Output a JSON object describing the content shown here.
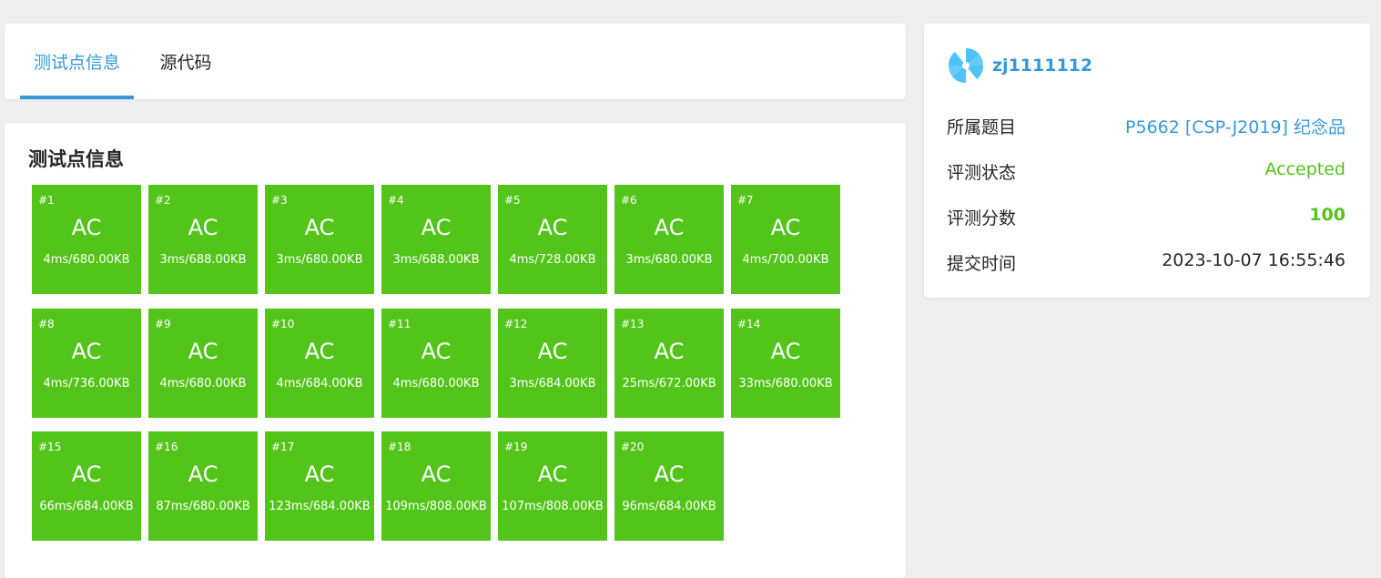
{
  "tabs": [
    {
      "label": "测试点信息",
      "active": true
    },
    {
      "label": "源代码",
      "active": false
    }
  ],
  "testcases": {
    "title": "测试点信息",
    "status_color": "#52c41a",
    "cases": [
      {
        "id": "#1",
        "status": "AC",
        "usage": "4ms/680.00KB"
      },
      {
        "id": "#2",
        "status": "AC",
        "usage": "3ms/688.00KB"
      },
      {
        "id": "#3",
        "status": "AC",
        "usage": "3ms/680.00KB"
      },
      {
        "id": "#4",
        "status": "AC",
        "usage": "3ms/688.00KB"
      },
      {
        "id": "#5",
        "status": "AC",
        "usage": "4ms/728.00KB"
      },
      {
        "id": "#6",
        "status": "AC",
        "usage": "3ms/680.00KB"
      },
      {
        "id": "#7",
        "status": "AC",
        "usage": "4ms/700.00KB"
      },
      {
        "id": "#8",
        "status": "AC",
        "usage": "4ms/736.00KB"
      },
      {
        "id": "#9",
        "status": "AC",
        "usage": "4ms/680.00KB"
      },
      {
        "id": "#10",
        "status": "AC",
        "usage": "4ms/684.00KB"
      },
      {
        "id": "#11",
        "status": "AC",
        "usage": "4ms/680.00KB"
      },
      {
        "id": "#12",
        "status": "AC",
        "usage": "3ms/684.00KB"
      },
      {
        "id": "#13",
        "status": "AC",
        "usage": "25ms/672.00KB"
      },
      {
        "id": "#14",
        "status": "AC",
        "usage": "33ms/680.00KB"
      },
      {
        "id": "#15",
        "status": "AC",
        "usage": "66ms/684.00KB"
      },
      {
        "id": "#16",
        "status": "AC",
        "usage": "87ms/680.00KB"
      },
      {
        "id": "#17",
        "status": "AC",
        "usage": "123ms/684.00KB"
      },
      {
        "id": "#18",
        "status": "AC",
        "usage": "109ms/808.00KB"
      },
      {
        "id": "#19",
        "status": "AC",
        "usage": "107ms/808.00KB"
      },
      {
        "id": "#20",
        "status": "AC",
        "usage": "96ms/684.00KB"
      }
    ]
  },
  "info": {
    "username": "zj1111112",
    "avatar_icon": "pinwheel-avatar-icon",
    "avatar_color": "#4fc3f7",
    "rows": [
      {
        "label": "所属题目",
        "value": "P5662 [CSP-J2019] 纪念品",
        "style": "link"
      },
      {
        "label": "评测状态",
        "value": "Accepted",
        "style": "accepted"
      },
      {
        "label": "评测分数",
        "value": "100",
        "style": "score"
      },
      {
        "label": "提交时间",
        "value": "2023-10-07 16:55:46",
        "style": "plain"
      }
    ]
  }
}
